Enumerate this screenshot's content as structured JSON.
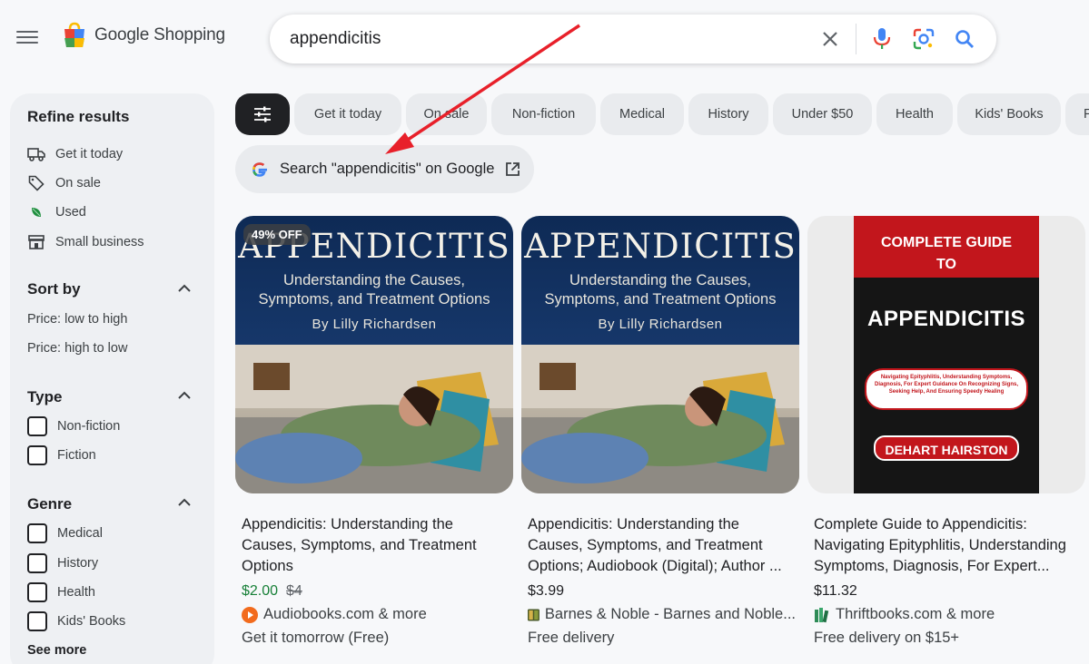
{
  "header": {
    "logo_text": "Google Shopping",
    "search_value": "appendicitis",
    "icons": [
      "menu-icon",
      "clear-icon",
      "mic-icon",
      "lens-icon",
      "search-icon"
    ]
  },
  "sidebar": {
    "title": "Refine results",
    "quick_filters": [
      {
        "label": "Get it today",
        "icon": "truck-icon"
      },
      {
        "label": "On sale",
        "icon": "tag-icon"
      },
      {
        "label": "Used",
        "icon": "leaf-icon"
      },
      {
        "label": "Small business",
        "icon": "store-icon"
      }
    ],
    "sort": {
      "heading": "Sort by",
      "options": [
        "Price: low to high",
        "Price: high to low"
      ]
    },
    "type": {
      "heading": "Type",
      "options": [
        "Non-fiction",
        "Fiction"
      ]
    },
    "genre": {
      "heading": "Genre",
      "options": [
        "Medical",
        "History",
        "Health",
        "Kids' Books"
      ],
      "see_more": "See more"
    }
  },
  "chips": [
    "Get it today",
    "On sale",
    "Non-fiction",
    "Medical",
    "History",
    "Under $50",
    "Health",
    "Kids' Books",
    "F"
  ],
  "google_search": {
    "label": "Search \"appendicitis\" on Google"
  },
  "products": [
    {
      "badge": "49% OFF",
      "cover_title": "APPENDICITIS",
      "cover_subtitle_1": "Understanding the Causes,",
      "cover_subtitle_2": "Symptoms, and Treatment Options",
      "cover_author": "By Lilly Richardsen",
      "title": "Appendicitis: Understanding the Causes, Symptoms, and Treatment Options",
      "price": "$2.00",
      "old_price": "$4",
      "seller": "Audiobooks.com & more",
      "delivery": "Get it tomorrow (Free)"
    },
    {
      "cover_title": "APPENDICITIS",
      "cover_subtitle_1": "Understanding the Causes,",
      "cover_subtitle_2": "Symptoms, and Treatment Options",
      "cover_author": "By Lilly Richardsen",
      "title": "Appendicitis: Understanding the Causes, Symptoms, and Treatment Options; Audiobook (Digital); Author ...",
      "price": "$3.99",
      "seller": "Barnes & Noble - Barnes and Noble...",
      "delivery": "Free delivery"
    },
    {
      "cover_top": "COMPLETE GUIDE TO",
      "cover_title": "APPENDICITIS",
      "cover_blurb": "Navigating Epityphlitis, Understanding Symptoms, Diagnosis, For Expert Guidance On Recognizing Signs, Seeking Help, And Ensuring Speedy Healing",
      "cover_author": "DEHART HAIRSTON",
      "title": "Complete Guide to Appendicitis: Navigating Epityphlitis, Understanding Symptoms, Diagnosis, For Expert...",
      "price": "$11.32",
      "seller": "Thriftbooks.com & more",
      "delivery": "Free delivery on $15+"
    }
  ],
  "annotation": {
    "color": "#e8202a"
  }
}
